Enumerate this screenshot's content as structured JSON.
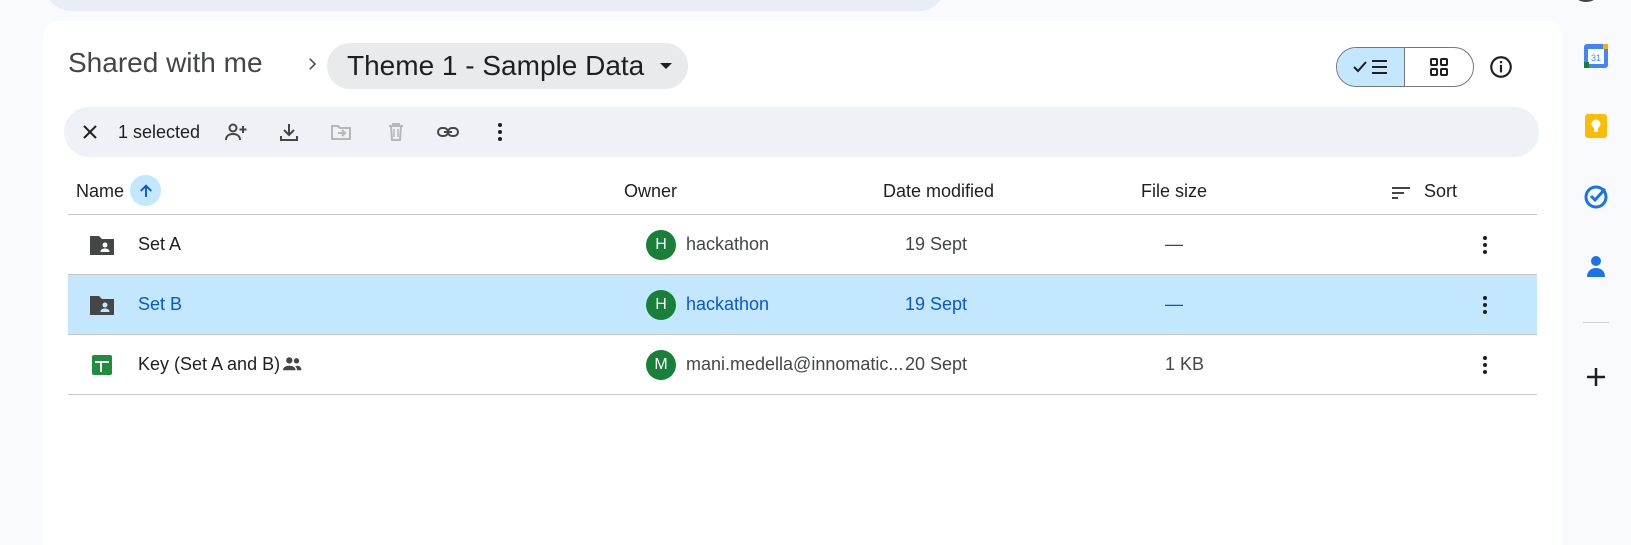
{
  "breadcrumb": {
    "root": "Shared with me",
    "current": "Theme 1 - Sample Data"
  },
  "view_toggle": {
    "active": "list"
  },
  "selection_bar": {
    "count_label": "1 selected",
    "actions": [
      "share-icon",
      "download-icon",
      "move-icon",
      "trash-icon",
      "link-icon",
      "more-vert-icon"
    ]
  },
  "table": {
    "columns": {
      "name": "Name",
      "owner": "Owner",
      "date_modified": "Date modified",
      "file_size": "File size",
      "sort": "Sort"
    },
    "rows": [
      {
        "name": "Set A",
        "type": "shared-folder",
        "owner_initial": "H",
        "owner": "hackathon",
        "date": "19 Sept",
        "size": "—",
        "selected": false,
        "shared": false
      },
      {
        "name": "Set B",
        "type": "shared-folder",
        "owner_initial": "H",
        "owner": "hackathon",
        "date": "19 Sept",
        "size": "—",
        "selected": true,
        "shared": false
      },
      {
        "name": "Key (Set A and B)",
        "type": "spreadsheet",
        "owner_initial": "M",
        "owner": "mani.medella@innomatic...",
        "date": "20 Sept",
        "size": "1 KB",
        "selected": false,
        "shared": true
      }
    ]
  },
  "colors": {
    "selected_row": "#c2e7ff",
    "avatar": "#188038",
    "accent": "#0b57d0"
  },
  "side_panel": {
    "apps": [
      "calendar-icon",
      "keep-icon",
      "tasks-icon",
      "contacts-icon",
      "add-icon"
    ]
  }
}
